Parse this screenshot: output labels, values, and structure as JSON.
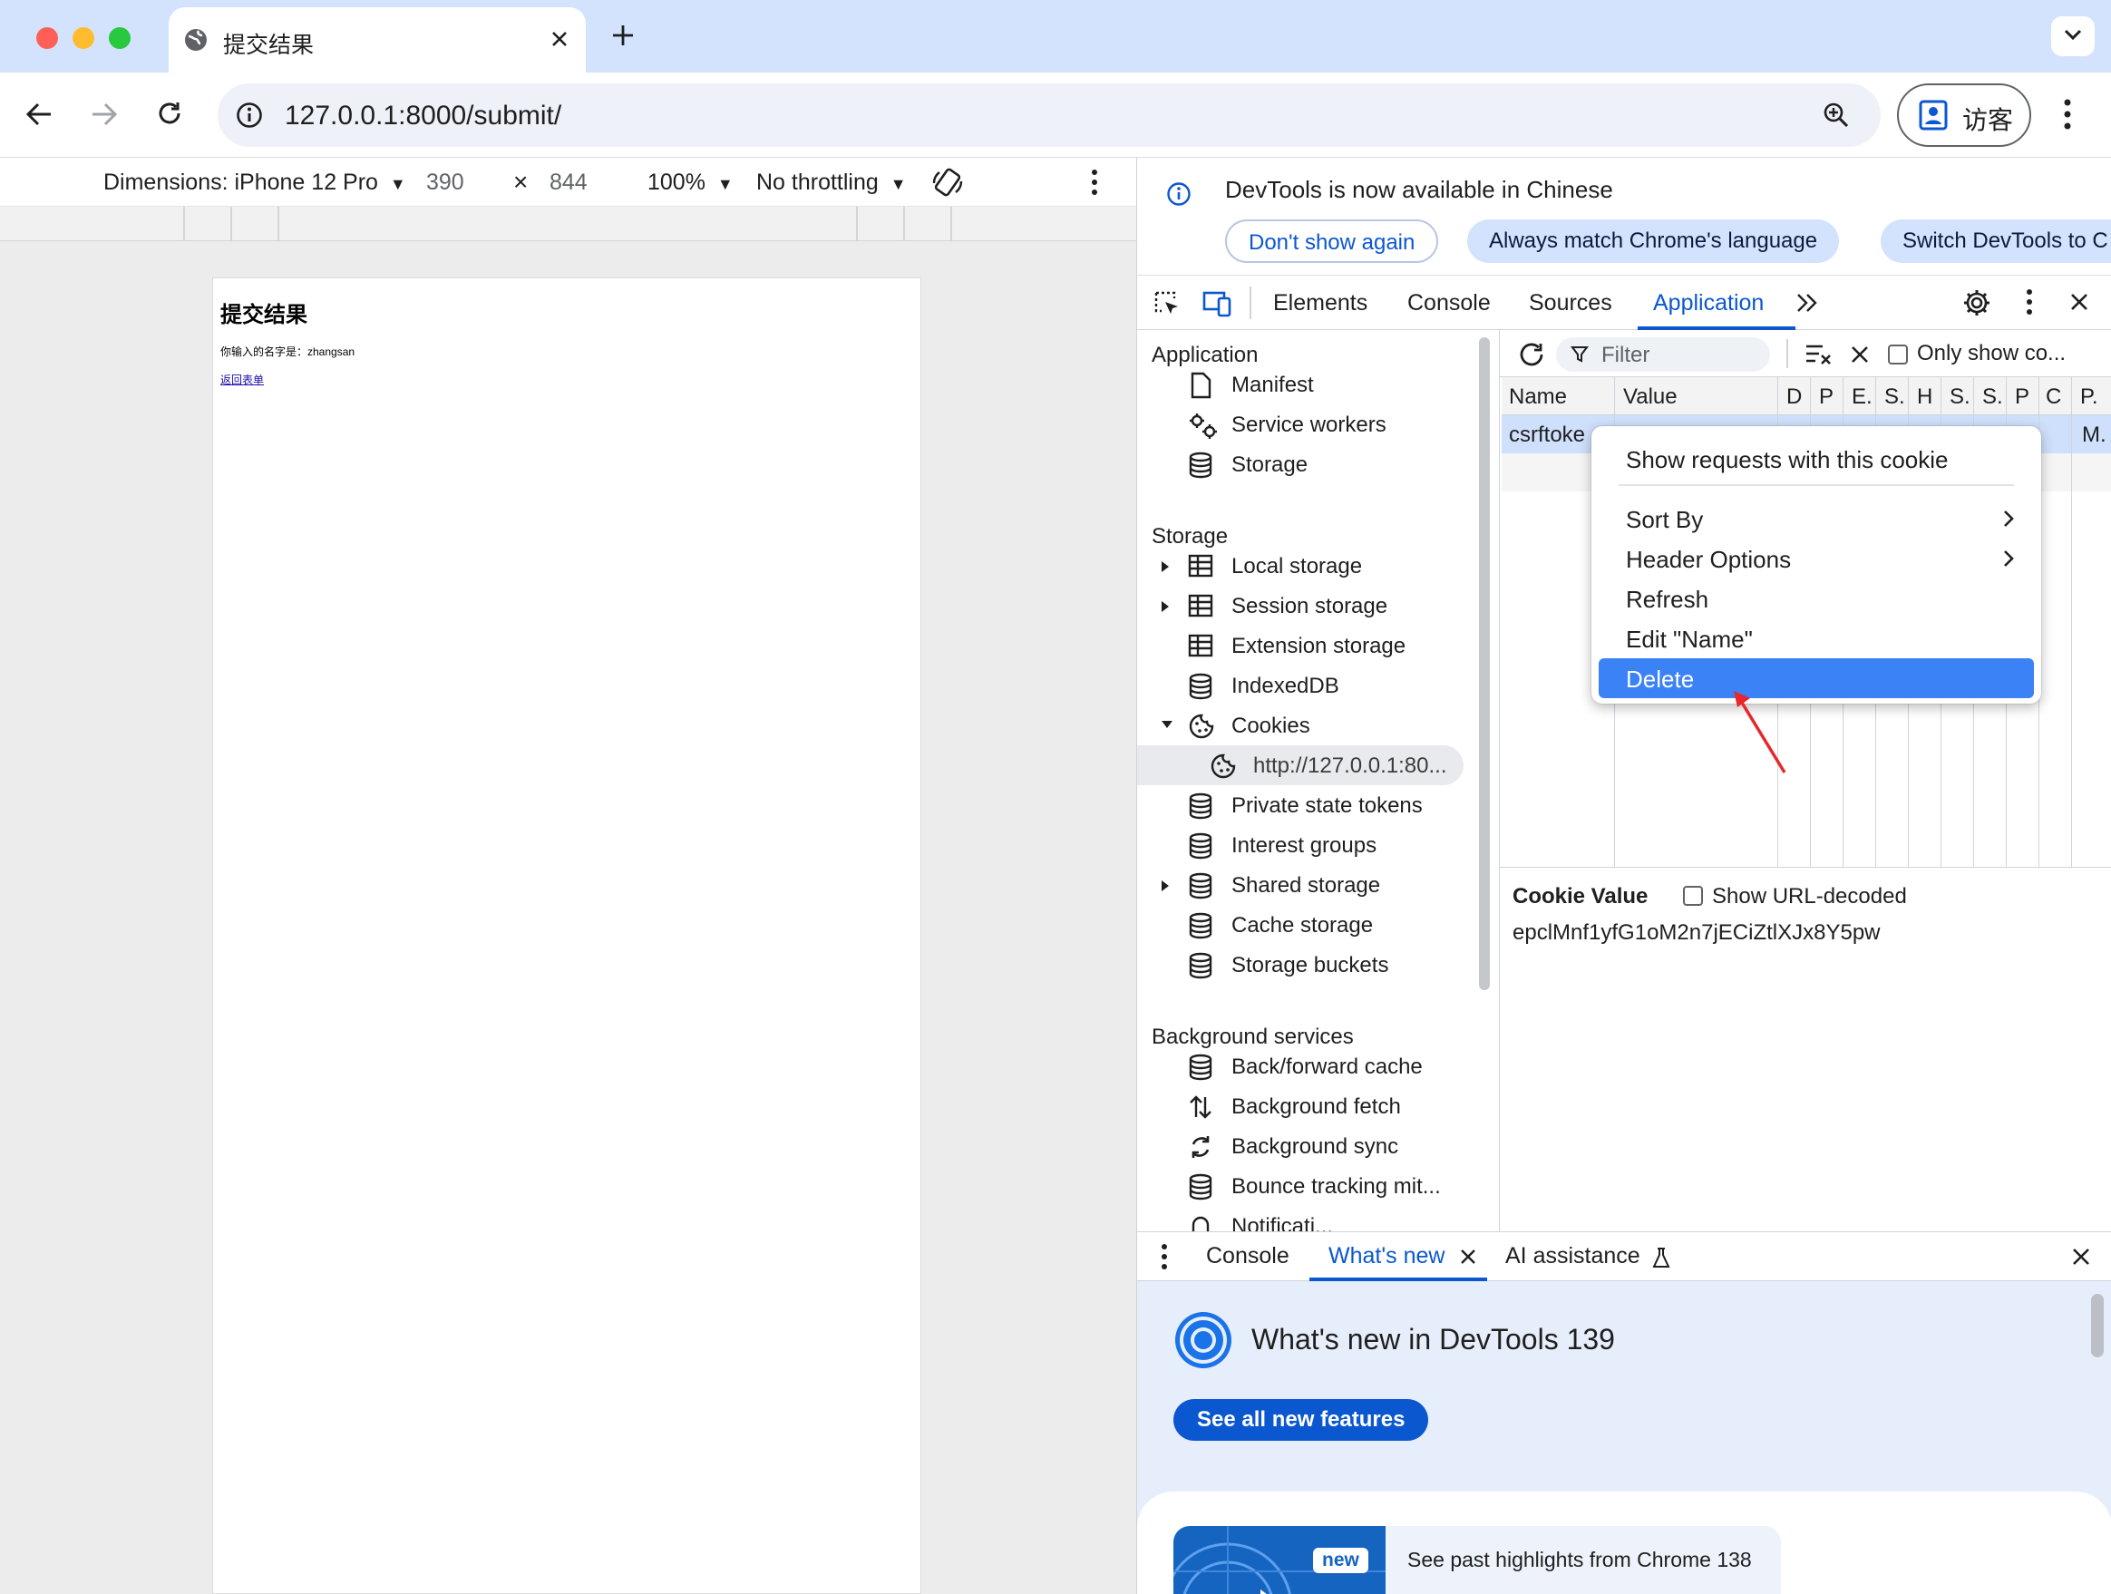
{
  "browser": {
    "tab_title": "提交结果",
    "url": "127.0.0.1:8000/submit/",
    "profile_label": "访客"
  },
  "device_toolbar": {
    "dimensions_label": "Dimensions: iPhone 12 Pro",
    "width": "390",
    "times": "×",
    "height": "844",
    "zoom": "100%",
    "throttling": "No throttling"
  },
  "page": {
    "heading": "提交结果",
    "message": "你输入的名字是：zhangsan",
    "back_link": "返回表单"
  },
  "devtools": {
    "info_text": "DevTools is now available in Chinese",
    "btn_dont_show": "Don't show again",
    "btn_match_lang": "Always match Chrome's language",
    "btn_switch": "Switch DevTools to C",
    "tabs": [
      "Elements",
      "Console",
      "Sources",
      "Application"
    ],
    "active_tab": "Application",
    "sidebar": {
      "application_header": "Application",
      "application_items": [
        "Manifest",
        "Service workers",
        "Storage"
      ],
      "storage_header": "Storage",
      "storage_items": [
        "Local storage",
        "Session storage",
        "Extension storage",
        "IndexedDB",
        "Cookies",
        "http://127.0.0.1:80...",
        "Private state tokens",
        "Interest groups",
        "Shared storage",
        "Cache storage",
        "Storage buckets"
      ],
      "bg_header": "Background services",
      "bg_items": [
        "Back/forward cache",
        "Background fetch",
        "Background sync",
        "Bounce tracking mit...",
        "Notificati..."
      ]
    },
    "cookies": {
      "filter_placeholder": "Filter",
      "only_show": "Only show co...",
      "columns": [
        "Name",
        "Value",
        "D",
        "P",
        "E.",
        "S.",
        "H",
        "S.",
        "S.",
        "P",
        "C",
        "P."
      ],
      "selected_row_name": "csrftoke",
      "selected_row_last": "M.",
      "cookie_value_label": "Cookie Value",
      "show_url_decoded": "Show URL-decoded",
      "cookie_value": "epclMnf1yfG1oM2n7jECiZtlXJx8Y5pw"
    },
    "context_menu": {
      "show_requests": "Show requests with this cookie",
      "sort_by": "Sort By",
      "header_options": "Header Options",
      "refresh": "Refresh",
      "edit_name": "Edit \"Name\"",
      "delete": "Delete"
    },
    "drawer": {
      "tabs": [
        "Console",
        "What's new",
        "AI assistance"
      ],
      "active_tab": "What's new",
      "whats_new_title": "What's new in DevTools 139",
      "see_all_button": "See all new features",
      "badge_new": "new",
      "highlight_text": "See past highlights from Chrome 138"
    }
  },
  "colors": {
    "accent": "#0b57d0",
    "tabstrip": "#d3e3fd",
    "menu_highlight": "#3b82f6",
    "annotation_arrow": "#e8262b"
  }
}
